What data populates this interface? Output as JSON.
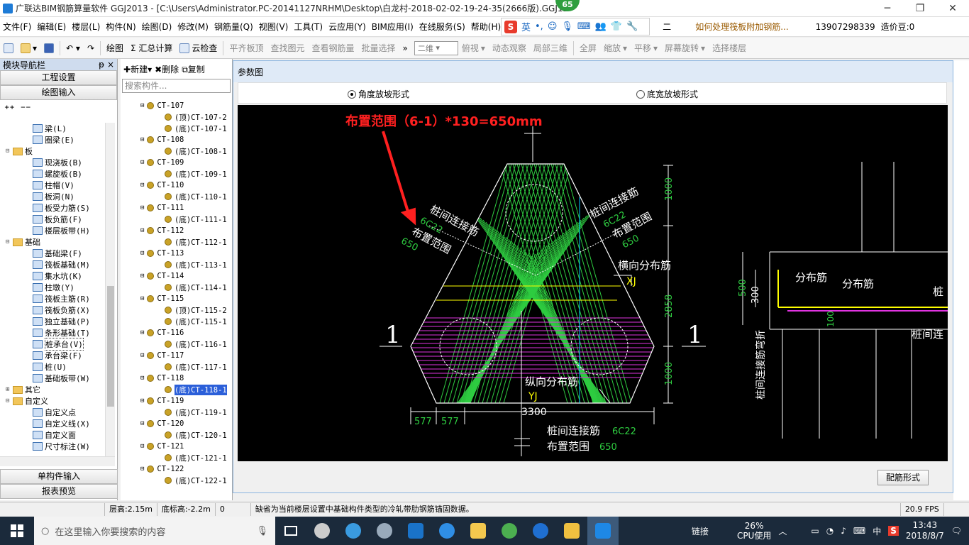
{
  "window": {
    "title": "广联达BIM钢筋算量软件 GGJ2013 - [C:\\Users\\Administrator.PC-20141127NRHM\\Desktop\\白龙村-2018-02-02-19-24-35(2666版).GGJ12",
    "badge": "65",
    "min": "─",
    "restore": "❐",
    "close": "✕"
  },
  "menu": [
    "文件(F)",
    "编辑(E)",
    "楼层(L)",
    "构件(N)",
    "绘图(D)",
    "修改(M)",
    "钢筋量(Q)",
    "视图(V)",
    "工具(T)",
    "云应用(Y)",
    "BIM应用(I)",
    "在线服务(S)",
    "帮助(H)"
  ],
  "menu_right": {
    "partial": "二",
    "link": "如何处理筏板附加钢筋...",
    "phone": "13907298339",
    "price": "造价豆:0"
  },
  "ime": {
    "logo": "S",
    "lang": "英"
  },
  "toolbar": [
    {
      "label": "绘图",
      "dis": false
    },
    {
      "label": "Σ 汇总计算",
      "dis": false
    },
    {
      "label": "云检查",
      "dis": false
    },
    {
      "label": "平齐板顶",
      "dis": true
    },
    {
      "label": "查找图元",
      "dis": true
    },
    {
      "label": "查看钢筋量",
      "dis": true
    },
    {
      "label": "批量选择",
      "dis": true
    }
  ],
  "toolbar2": {
    "view": "二维",
    "items": [
      "俯视",
      "动态观察",
      "局部三维",
      "全屏",
      "缩放",
      "平移",
      "屏幕旋转",
      "选择楼层"
    ]
  },
  "left": {
    "header": "模块导航栏",
    "pin": "ᵽ ×",
    "project": "工程设置",
    "draw": "绘图输入",
    "single": "单构件输入",
    "report": "报表预览",
    "tree": [
      {
        "lvl": 2,
        "t": "梁(L)",
        "k": "c"
      },
      {
        "lvl": 2,
        "t": "圈梁(E)",
        "k": "c"
      },
      {
        "lvl": 0,
        "t": "板",
        "k": "f",
        "tg": "⊟"
      },
      {
        "lvl": 2,
        "t": "现浇板(B)",
        "k": "c"
      },
      {
        "lvl": 2,
        "t": "螺旋板(B)",
        "k": "c"
      },
      {
        "lvl": 2,
        "t": "柱帽(V)",
        "k": "c"
      },
      {
        "lvl": 2,
        "t": "板洞(N)",
        "k": "c"
      },
      {
        "lvl": 2,
        "t": "板受力筋(S)",
        "k": "c"
      },
      {
        "lvl": 2,
        "t": "板负筋(F)",
        "k": "c"
      },
      {
        "lvl": 2,
        "t": "楼层板带(H)",
        "k": "c"
      },
      {
        "lvl": 0,
        "t": "基础",
        "k": "f",
        "tg": "⊟"
      },
      {
        "lvl": 2,
        "t": "基础梁(F)",
        "k": "c"
      },
      {
        "lvl": 2,
        "t": "筏板基础(M)",
        "k": "c"
      },
      {
        "lvl": 2,
        "t": "集水坑(K)",
        "k": "c"
      },
      {
        "lvl": 2,
        "t": "柱墩(Y)",
        "k": "c"
      },
      {
        "lvl": 2,
        "t": "筏板主筋(R)",
        "k": "c"
      },
      {
        "lvl": 2,
        "t": "筏板负筋(X)",
        "k": "c"
      },
      {
        "lvl": 2,
        "t": "独立基础(P)",
        "k": "c"
      },
      {
        "lvl": 2,
        "t": "条形基础(T)",
        "k": "c"
      },
      {
        "lvl": 2,
        "t": "桩承台(V)",
        "k": "c",
        "sel": true
      },
      {
        "lvl": 2,
        "t": "承台梁(F)",
        "k": "c"
      },
      {
        "lvl": 2,
        "t": "桩(U)",
        "k": "c"
      },
      {
        "lvl": 2,
        "t": "基础板带(W)",
        "k": "c"
      },
      {
        "lvl": 0,
        "t": "其它",
        "k": "f",
        "tg": "⊞"
      },
      {
        "lvl": 0,
        "t": "自定义",
        "k": "f",
        "tg": "⊟"
      },
      {
        "lvl": 2,
        "t": "自定义点",
        "k": "c"
      },
      {
        "lvl": 2,
        "t": "自定义线(X)",
        "k": "c"
      },
      {
        "lvl": 2,
        "t": "自定义面",
        "k": "c"
      },
      {
        "lvl": 2,
        "t": "尺寸标注(W)",
        "k": "c"
      }
    ]
  },
  "mid": {
    "new": "新建",
    "delete": "删除",
    "copy": "复制",
    "search_placeholder": "搜索构件...",
    "list": [
      {
        "t": "CT-107",
        "h": 1
      },
      {
        "t": "(顶)CT-107-2"
      },
      {
        "t": "(底)CT-107-1"
      },
      {
        "t": "CT-108",
        "h": 1
      },
      {
        "t": "(底)CT-108-1"
      },
      {
        "t": "CT-109",
        "h": 1
      },
      {
        "t": "(底)CT-109-1"
      },
      {
        "t": "CT-110",
        "h": 1
      },
      {
        "t": "(底)CT-110-1"
      },
      {
        "t": "CT-111",
        "h": 1
      },
      {
        "t": "(底)CT-111-1"
      },
      {
        "t": "CT-112",
        "h": 1
      },
      {
        "t": "(底)CT-112-1"
      },
      {
        "t": "CT-113",
        "h": 1
      },
      {
        "t": "(底)CT-113-1"
      },
      {
        "t": "CT-114",
        "h": 1
      },
      {
        "t": "(底)CT-114-1"
      },
      {
        "t": "CT-115",
        "h": 1
      },
      {
        "t": "(顶)CT-115-2"
      },
      {
        "t": "(底)CT-115-1"
      },
      {
        "t": "CT-116",
        "h": 1
      },
      {
        "t": "(底)CT-116-1"
      },
      {
        "t": "CT-117",
        "h": 1
      },
      {
        "t": "(底)CT-117-1"
      },
      {
        "t": "CT-118",
        "h": 1
      },
      {
        "t": "(底)CT-118-1",
        "sel": true
      },
      {
        "t": "CT-119",
        "h": 1
      },
      {
        "t": "(底)CT-119-1"
      },
      {
        "t": "CT-120",
        "h": 1
      },
      {
        "t": "(底)CT-120-1"
      },
      {
        "t": "CT-121",
        "h": 1
      },
      {
        "t": "(底)CT-121-1"
      },
      {
        "t": "CT-122",
        "h": 1
      },
      {
        "t": "(底)CT-122-1"
      }
    ]
  },
  "dialog": {
    "title": "参数图",
    "radio1": "角度放坡形式",
    "radio2": "底宽放坡形式",
    "button": "配筋形式"
  },
  "drawing": {
    "annotation": "布置范围（6-1）*130=650mm",
    "left_label1": "桩间连接筋",
    "left_label1_v": "6C22",
    "left_label2": "布置范围",
    "left_label2_v": "650",
    "right_label1": "桩间连接筋",
    "right_label1_v": "6C22",
    "right_label2": "布置范围",
    "right_label2_v": "650",
    "transverse": "横向分布筋",
    "xj": "XJ",
    "longitudinal": "纵向分布筋",
    "yj": "YJ",
    "dim_top": "1000",
    "dim_mid": "2858",
    "dim_bot": "1000",
    "dim_width": "3300",
    "dim_577a": "577",
    "dim_577b": "577",
    "bottom_label1": "桩间连接筋",
    "bottom_label1_v": "6C22",
    "bottom_label2": "布置范围",
    "bottom_label2_v": "650",
    "section_left": "1",
    "section_right": "1",
    "sec_dim500": "500",
    "sec_dim300": "300",
    "sec_dim100": "100",
    "sec_v": "桩间连接筋弯折",
    "sec_fb1": "分布筋",
    "sec_fb2": "分布筋",
    "sec_zhuang": "桩",
    "sec_zhuanglian": "桩间连"
  },
  "status": {
    "floor_h": "层高:2.15m",
    "bottom_h": "底标高:-2.2m",
    "zero": "0",
    "msg": "缺省为当前楼层设置中基础构件类型的冷轧带肋钢筋锚固数据。",
    "fps": "20.9 FPS"
  },
  "taskbar": {
    "search": "在这里输入你要搜索的内容",
    "link": "链接",
    "cpu_pct": "26%",
    "cpu": "CPU使用",
    "lang": "中",
    "time": "13:43",
    "date": "2018/8/7"
  }
}
